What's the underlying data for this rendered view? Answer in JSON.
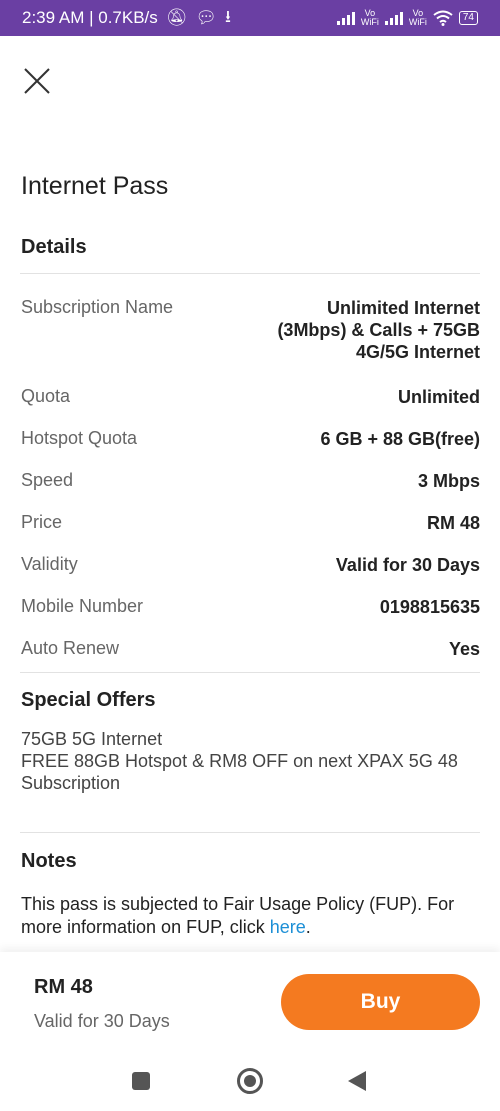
{
  "status_bar": {
    "time_info": "2:39 AM | 0.7KB/s",
    "vowifi": "Vo\nWiFi",
    "battery": "74"
  },
  "page": {
    "title": "Internet Pass"
  },
  "details": {
    "title": "Details",
    "rows": [
      {
        "label": "Subscription Name",
        "value": "Unlimited Internet\n(3Mbps) & Calls + 75GB\n4G/5G Internet"
      },
      {
        "label": "Quota",
        "value": "Unlimited"
      },
      {
        "label": "Hotspot Quota",
        "value": "6 GB + 88 GB(free)"
      },
      {
        "label": "Speed",
        "value": "3 Mbps"
      },
      {
        "label": "Price",
        "value": "RM 48"
      },
      {
        "label": "Validity",
        "value": "Valid for 30 Days"
      },
      {
        "label": "Mobile Number",
        "value": "0198815635"
      },
      {
        "label": "Auto Renew",
        "value": "Yes"
      }
    ]
  },
  "special_offers": {
    "title": "Special Offers",
    "line1": "75GB 5G Internet",
    "line2": "FREE 88GB Hotspot & RM8 OFF on next XPAX 5G 48 Subscription"
  },
  "notes": {
    "title": "Notes",
    "text": "This pass is subjected to Fair Usage Policy (FUP). For more information on FUP, click ",
    "link": "here",
    "suffix": "."
  },
  "footer": {
    "price": "RM 48",
    "validity": "Valid for 30 Days",
    "buy_label": "Buy"
  },
  "colors": {
    "status_bar": "#6a3fa3",
    "buy_button": "#f47a20",
    "link": "#1c8fd6"
  }
}
